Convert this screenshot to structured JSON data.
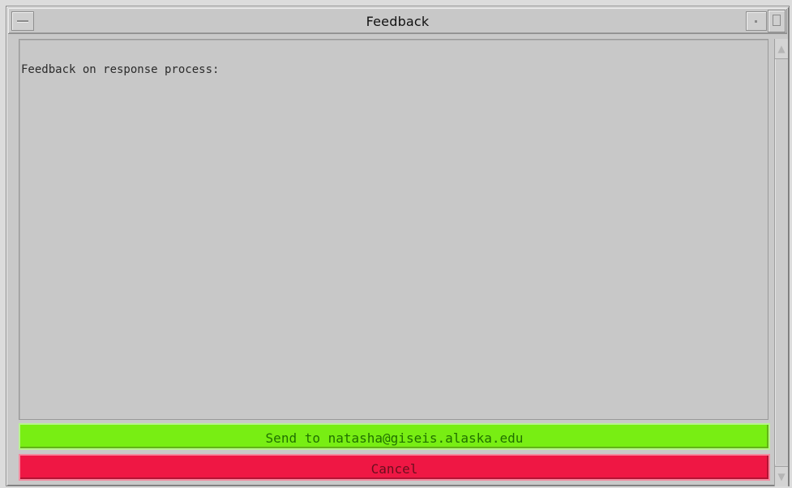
{
  "window": {
    "title": "Feedback"
  },
  "text_area": {
    "value": "Feedback on response process:"
  },
  "scrollbar": {
    "up_icon": "▲",
    "down_icon": "▼"
  },
  "buttons": {
    "send_label": "Send to natasha@giseis.alaska.edu",
    "cancel_label": "Cancel"
  },
  "colors": {
    "send_button": "#78ee13",
    "cancel_button": "#ef1744",
    "window_background": "#c9c9c9"
  },
  "icons": {
    "window_menu": "window-menu-icon",
    "minimize": "minimize-icon",
    "maximize": "maximize-icon",
    "scroll_up": "scroll-up-icon",
    "scroll_down": "scroll-down-icon"
  }
}
